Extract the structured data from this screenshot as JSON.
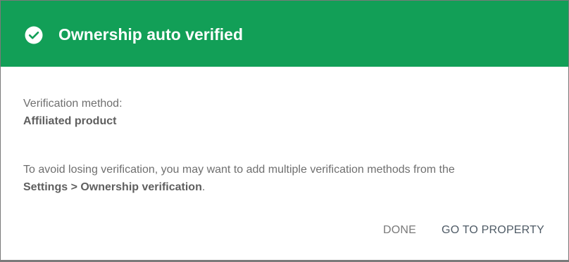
{
  "header": {
    "title": "Ownership auto verified",
    "icon": "check-circle-icon",
    "background_color": "#129f57"
  },
  "verification": {
    "method_label": "Verification method:",
    "method_value": "Affiliated product"
  },
  "note": {
    "text": "To avoid losing verification, you may want to add multiple verification methods from the",
    "link_text": "Settings > Ownership verification",
    "suffix": "."
  },
  "actions": {
    "done_label": "DONE",
    "go_label": "GO TO PROPERTY"
  }
}
